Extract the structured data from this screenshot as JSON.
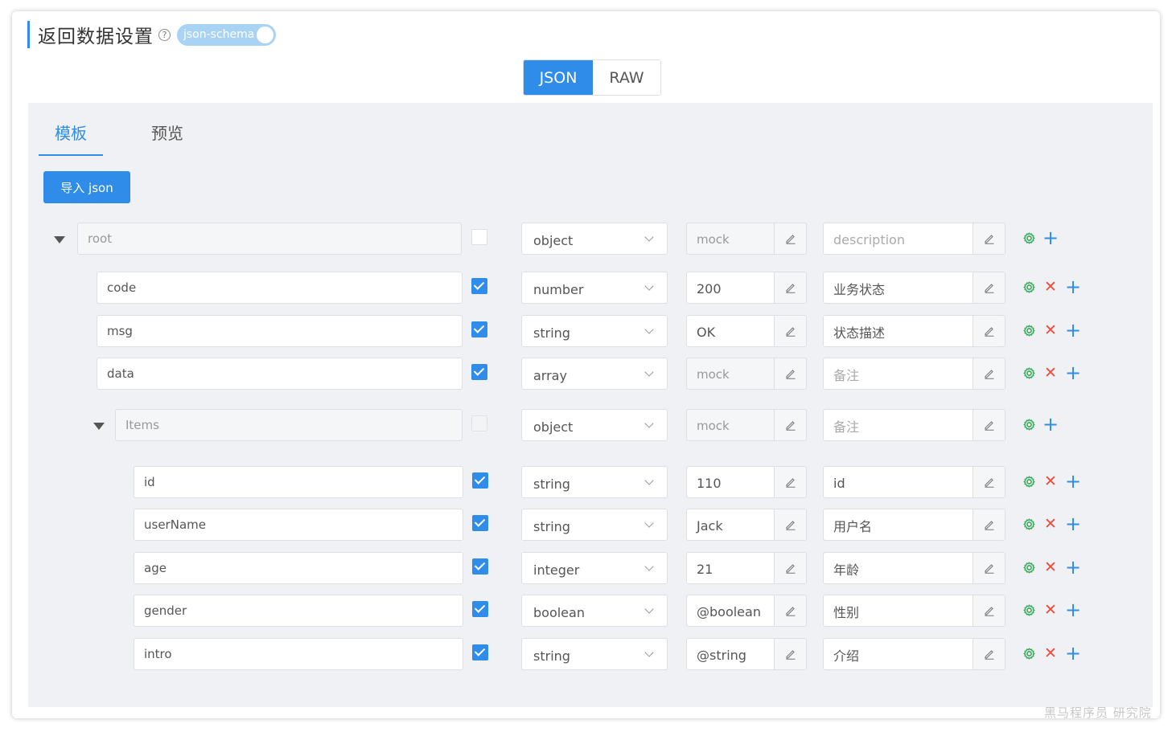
{
  "header": {
    "title": "返回数据设置",
    "help": "?",
    "toggle_label": "json-schema"
  },
  "mode_tabs": {
    "json": "JSON",
    "raw": "RAW"
  },
  "tabs": {
    "template": "模板",
    "preview": "预览"
  },
  "import_button": "导入 json",
  "rows": [
    {
      "name": "root",
      "level": 0,
      "collapsible": true,
      "disabled": true,
      "required": false,
      "type": "object",
      "mock": "mock",
      "mock_placeholder": true,
      "desc": "description",
      "desc_placeholder": true,
      "deletable": false
    },
    {
      "name": "code",
      "level": 1,
      "collapsible": false,
      "disabled": false,
      "required": true,
      "type": "number",
      "mock": "200",
      "mock_placeholder": false,
      "desc": "业务状态",
      "desc_placeholder": false,
      "deletable": true
    },
    {
      "name": "msg",
      "level": 1,
      "collapsible": false,
      "disabled": false,
      "required": true,
      "type": "string",
      "mock": "OK",
      "mock_placeholder": false,
      "desc": "状态描述",
      "desc_placeholder": false,
      "deletable": true
    },
    {
      "name": "data",
      "level": 1,
      "collapsible": false,
      "disabled": false,
      "required": true,
      "type": "array",
      "mock": "mock",
      "mock_placeholder": true,
      "desc": "备注",
      "desc_placeholder": true,
      "deletable": true
    },
    {
      "name": "Items",
      "level": 1,
      "collapsible": true,
      "disabled": true,
      "required": false,
      "type": "object",
      "mock": "mock",
      "mock_placeholder": true,
      "desc": "备注",
      "desc_placeholder": true,
      "deletable": false
    },
    {
      "name": "id",
      "level": 2,
      "collapsible": false,
      "disabled": false,
      "required": true,
      "type": "string",
      "mock": "110",
      "mock_placeholder": false,
      "desc": "id",
      "desc_placeholder": false,
      "deletable": true
    },
    {
      "name": "userName",
      "level": 2,
      "collapsible": false,
      "disabled": false,
      "required": true,
      "type": "string",
      "mock": "Jack",
      "mock_placeholder": false,
      "desc": "用户名",
      "desc_placeholder": false,
      "deletable": true
    },
    {
      "name": "age",
      "level": 2,
      "collapsible": false,
      "disabled": false,
      "required": true,
      "type": "integer",
      "mock": "21",
      "mock_placeholder": false,
      "desc": "年龄",
      "desc_placeholder": false,
      "deletable": true
    },
    {
      "name": "gender",
      "level": 2,
      "collapsible": false,
      "disabled": false,
      "required": true,
      "type": "boolean",
      "mock": "@boolean",
      "mock_placeholder": false,
      "desc": "性别",
      "desc_placeholder": false,
      "deletable": true
    },
    {
      "name": "intro",
      "level": 2,
      "collapsible": false,
      "disabled": false,
      "required": true,
      "type": "string",
      "mock": "@string",
      "mock_placeholder": false,
      "desc": "介绍",
      "desc_placeholder": false,
      "deletable": true
    }
  ],
  "watermark": "黑马程序员 研究院",
  "colors": {
    "accent": "#2f8ce8",
    "settings": "#3aa55a",
    "delete": "#f04a3a"
  }
}
